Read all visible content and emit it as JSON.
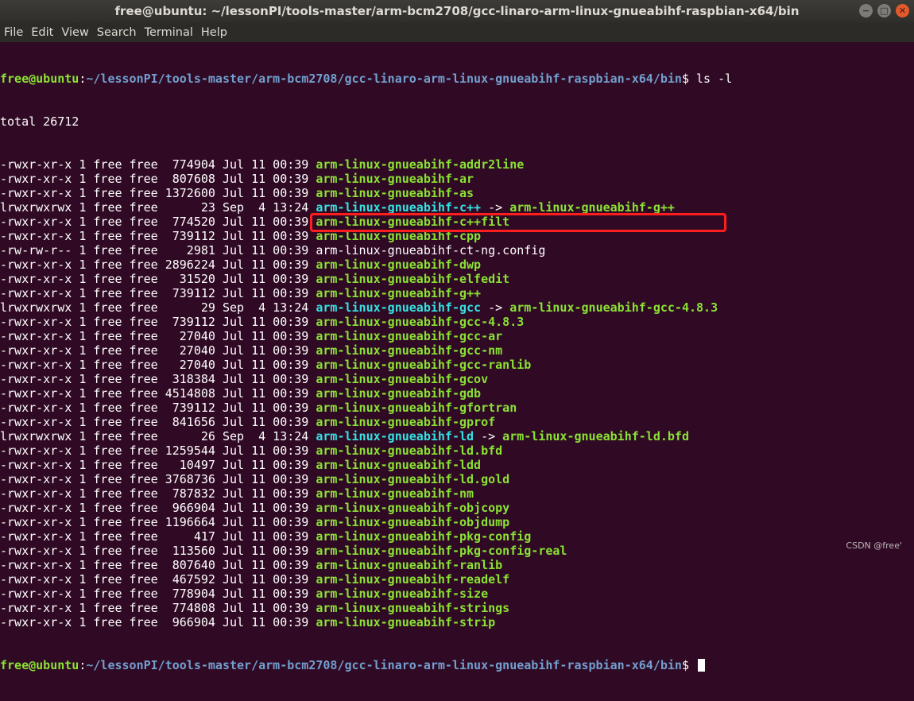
{
  "window": {
    "title": "free@ubuntu: ~/lessonPI/tools-master/arm-bcm2708/gcc-linaro-arm-linux-gnueabihf-raspbian-x64/bin",
    "buttons": [
      "−",
      "□",
      "✕"
    ]
  },
  "menu": [
    "File",
    "Edit",
    "View",
    "Search",
    "Terminal",
    "Help"
  ],
  "prompt": {
    "user": "free@ubuntu",
    "path": "~/lessonPI/tools-master/arm-bcm2708/gcc-linaro-arm-linux-gnueabihf-raspbian-x64/bin",
    "symbol": "$",
    "command": "ls -l"
  },
  "total": "total 26712",
  "files": [
    {
      "perms": "-rwxr-xr-x",
      "links": "1",
      "owner": "free",
      "group": "free",
      "size": "774904",
      "date": "Jul 11 00:39",
      "name": "arm-linux-gnueabihf-addr2line",
      "kind": "exec",
      "target": ""
    },
    {
      "perms": "-rwxr-xr-x",
      "links": "1",
      "owner": "free",
      "group": "free",
      "size": "807608",
      "date": "Jul 11 00:39",
      "name": "arm-linux-gnueabihf-ar",
      "kind": "exec",
      "target": ""
    },
    {
      "perms": "-rwxr-xr-x",
      "links": "1",
      "owner": "free",
      "group": "free",
      "size": "1372600",
      "date": "Jul 11 00:39",
      "name": "arm-linux-gnueabihf-as",
      "kind": "exec",
      "target": ""
    },
    {
      "perms": "lrwxrwxrwx",
      "links": "1",
      "owner": "free",
      "group": "free",
      "size": "23",
      "date": "Sep  4 13:24",
      "name": "arm-linux-gnueabihf-c++",
      "kind": "link",
      "target": "arm-linux-gnueabihf-g++"
    },
    {
      "perms": "-rwxr-xr-x",
      "links": "1",
      "owner": "free",
      "group": "free",
      "size": "774520",
      "date": "Jul 11 00:39",
      "name": "arm-linux-gnueabihf-c++filt",
      "kind": "exec",
      "target": ""
    },
    {
      "perms": "-rwxr-xr-x",
      "links": "1",
      "owner": "free",
      "group": "free",
      "size": "739112",
      "date": "Jul 11 00:39",
      "name": "arm-linux-gnueabihf-cpp",
      "kind": "exec",
      "target": ""
    },
    {
      "perms": "-rw-rw-r--",
      "links": "1",
      "owner": "free",
      "group": "free",
      "size": "2981",
      "date": "Jul 11 00:39",
      "name": "arm-linux-gnueabihf-ct-ng.config",
      "kind": "file",
      "target": ""
    },
    {
      "perms": "-rwxr-xr-x",
      "links": "1",
      "owner": "free",
      "group": "free",
      "size": "2896224",
      "date": "Jul 11 00:39",
      "name": "arm-linux-gnueabihf-dwp",
      "kind": "exec",
      "target": ""
    },
    {
      "perms": "-rwxr-xr-x",
      "links": "1",
      "owner": "free",
      "group": "free",
      "size": "31520",
      "date": "Jul 11 00:39",
      "name": "arm-linux-gnueabihf-elfedit",
      "kind": "exec",
      "target": ""
    },
    {
      "perms": "-rwxr-xr-x",
      "links": "1",
      "owner": "free",
      "group": "free",
      "size": "739112",
      "date": "Jul 11 00:39",
      "name": "arm-linux-gnueabihf-g++",
      "kind": "exec",
      "target": ""
    },
    {
      "perms": "lrwxrwxrwx",
      "links": "1",
      "owner": "free",
      "group": "free",
      "size": "29",
      "date": "Sep  4 13:24",
      "name": "arm-linux-gnueabihf-gcc",
      "kind": "link",
      "target": "arm-linux-gnueabihf-gcc-4.8.3"
    },
    {
      "perms": "-rwxr-xr-x",
      "links": "1",
      "owner": "free",
      "group": "free",
      "size": "739112",
      "date": "Jul 11 00:39",
      "name": "arm-linux-gnueabihf-gcc-4.8.3",
      "kind": "exec",
      "target": ""
    },
    {
      "perms": "-rwxr-xr-x",
      "links": "1",
      "owner": "free",
      "group": "free",
      "size": "27040",
      "date": "Jul 11 00:39",
      "name": "arm-linux-gnueabihf-gcc-ar",
      "kind": "exec",
      "target": ""
    },
    {
      "perms": "-rwxr-xr-x",
      "links": "1",
      "owner": "free",
      "group": "free",
      "size": "27040",
      "date": "Jul 11 00:39",
      "name": "arm-linux-gnueabihf-gcc-nm",
      "kind": "exec",
      "target": ""
    },
    {
      "perms": "-rwxr-xr-x",
      "links": "1",
      "owner": "free",
      "group": "free",
      "size": "27040",
      "date": "Jul 11 00:39",
      "name": "arm-linux-gnueabihf-gcc-ranlib",
      "kind": "exec",
      "target": ""
    },
    {
      "perms": "-rwxr-xr-x",
      "links": "1",
      "owner": "free",
      "group": "free",
      "size": "318384",
      "date": "Jul 11 00:39",
      "name": "arm-linux-gnueabihf-gcov",
      "kind": "exec",
      "target": ""
    },
    {
      "perms": "-rwxr-xr-x",
      "links": "1",
      "owner": "free",
      "group": "free",
      "size": "4514808",
      "date": "Jul 11 00:39",
      "name": "arm-linux-gnueabihf-gdb",
      "kind": "exec",
      "target": ""
    },
    {
      "perms": "-rwxr-xr-x",
      "links": "1",
      "owner": "free",
      "group": "free",
      "size": "739112",
      "date": "Jul 11 00:39",
      "name": "arm-linux-gnueabihf-gfortran",
      "kind": "exec",
      "target": ""
    },
    {
      "perms": "-rwxr-xr-x",
      "links": "1",
      "owner": "free",
      "group": "free",
      "size": "841656",
      "date": "Jul 11 00:39",
      "name": "arm-linux-gnueabihf-gprof",
      "kind": "exec",
      "target": ""
    },
    {
      "perms": "lrwxrwxrwx",
      "links": "1",
      "owner": "free",
      "group": "free",
      "size": "26",
      "date": "Sep  4 13:24",
      "name": "arm-linux-gnueabihf-ld",
      "kind": "link",
      "target": "arm-linux-gnueabihf-ld.bfd"
    },
    {
      "perms": "-rwxr-xr-x",
      "links": "1",
      "owner": "free",
      "group": "free",
      "size": "1259544",
      "date": "Jul 11 00:39",
      "name": "arm-linux-gnueabihf-ld.bfd",
      "kind": "exec",
      "target": ""
    },
    {
      "perms": "-rwxr-xr-x",
      "links": "1",
      "owner": "free",
      "group": "free",
      "size": "10497",
      "date": "Jul 11 00:39",
      "name": "arm-linux-gnueabihf-ldd",
      "kind": "exec",
      "target": ""
    },
    {
      "perms": "-rwxr-xr-x",
      "links": "1",
      "owner": "free",
      "group": "free",
      "size": "3768736",
      "date": "Jul 11 00:39",
      "name": "arm-linux-gnueabihf-ld.gold",
      "kind": "exec",
      "target": ""
    },
    {
      "perms": "-rwxr-xr-x",
      "links": "1",
      "owner": "free",
      "group": "free",
      "size": "787832",
      "date": "Jul 11 00:39",
      "name": "arm-linux-gnueabihf-nm",
      "kind": "exec",
      "target": ""
    },
    {
      "perms": "-rwxr-xr-x",
      "links": "1",
      "owner": "free",
      "group": "free",
      "size": "966904",
      "date": "Jul 11 00:39",
      "name": "arm-linux-gnueabihf-objcopy",
      "kind": "exec",
      "target": ""
    },
    {
      "perms": "-rwxr-xr-x",
      "links": "1",
      "owner": "free",
      "group": "free",
      "size": "1196664",
      "date": "Jul 11 00:39",
      "name": "arm-linux-gnueabihf-objdump",
      "kind": "exec",
      "target": ""
    },
    {
      "perms": "-rwxr-xr-x",
      "links": "1",
      "owner": "free",
      "group": "free",
      "size": "417",
      "date": "Jul 11 00:39",
      "name": "arm-linux-gnueabihf-pkg-config",
      "kind": "exec",
      "target": ""
    },
    {
      "perms": "-rwxr-xr-x",
      "links": "1",
      "owner": "free",
      "group": "free",
      "size": "113560",
      "date": "Jul 11 00:39",
      "name": "arm-linux-gnueabihf-pkg-config-real",
      "kind": "exec",
      "target": ""
    },
    {
      "perms": "-rwxr-xr-x",
      "links": "1",
      "owner": "free",
      "group": "free",
      "size": "807640",
      "date": "Jul 11 00:39",
      "name": "arm-linux-gnueabihf-ranlib",
      "kind": "exec",
      "target": ""
    },
    {
      "perms": "-rwxr-xr-x",
      "links": "1",
      "owner": "free",
      "group": "free",
      "size": "467592",
      "date": "Jul 11 00:39",
      "name": "arm-linux-gnueabihf-readelf",
      "kind": "exec",
      "target": ""
    },
    {
      "perms": "-rwxr-xr-x",
      "links": "1",
      "owner": "free",
      "group": "free",
      "size": "778904",
      "date": "Jul 11 00:39",
      "name": "arm-linux-gnueabihf-size",
      "kind": "exec",
      "target": ""
    },
    {
      "perms": "-rwxr-xr-x",
      "links": "1",
      "owner": "free",
      "group": "free",
      "size": "774808",
      "date": "Jul 11 00:39",
      "name": "arm-linux-gnueabihf-strings",
      "kind": "exec",
      "target": ""
    },
    {
      "perms": "-rwxr-xr-x",
      "links": "1",
      "owner": "free",
      "group": "free",
      "size": "966904",
      "date": "Jul 11 00:39",
      "name": "arm-linux-gnueabihf-strip",
      "kind": "exec",
      "target": ""
    }
  ],
  "watermark": "CSDN @free'",
  "colors": {
    "background": "#300a24",
    "executable": "#8ae234",
    "symlink": "#34e2e2",
    "path": "#729fcf",
    "highlight_box": "#ff1e1e"
  }
}
